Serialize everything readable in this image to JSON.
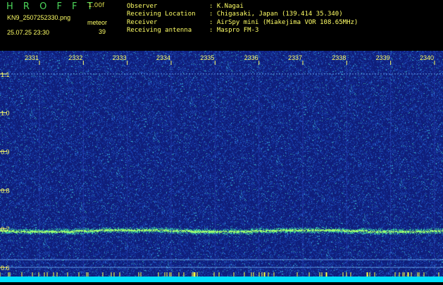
{
  "header": {
    "app_title": "H R O F F T",
    "version": "1.00f",
    "filename": "KN9_2507252330.png",
    "timestamp": "25.07.25 23:30",
    "meteor_label": "meteor",
    "meteor_count": "39"
  },
  "info": {
    "observer_label": "Observer",
    "observer_value": ": K.Nagai",
    "location_label": "Receiving Location",
    "location_value": ": Chigasaki, Japan (139.414 35.340)",
    "receiver_label": "Receiver",
    "receiver_value": ": AirSpy mini (Miakejima VOR 108.65MHz)",
    "antenna_label": "Receiving antenna",
    "antenna_value": ": Maspro FM-3"
  },
  "axis": {
    "unit": "kHz"
  },
  "colors": {
    "background": "#000000",
    "plot_bg": "#0f1e7a",
    "trace": "#7dff7a",
    "label": "#ffff66",
    "bottom_strip": "#00e0ff"
  },
  "chart_data": {
    "type": "heatmap",
    "x_ticks": [
      "2331",
      "2332",
      "2333",
      "2334",
      "2335",
      "2336",
      "2337",
      "2338",
      "2339",
      "2340"
    ],
    "y_ticks": [
      "1.1",
      "1.0",
      "0.9",
      "0.8",
      "0.7",
      "0.6"
    ],
    "ylim": [
      0.58,
      1.16
    ],
    "ylabel": "kHz",
    "carrier_khz": 0.695,
    "reference_lines_khz": [
      1.1,
      0.62,
      0.6
    ]
  }
}
